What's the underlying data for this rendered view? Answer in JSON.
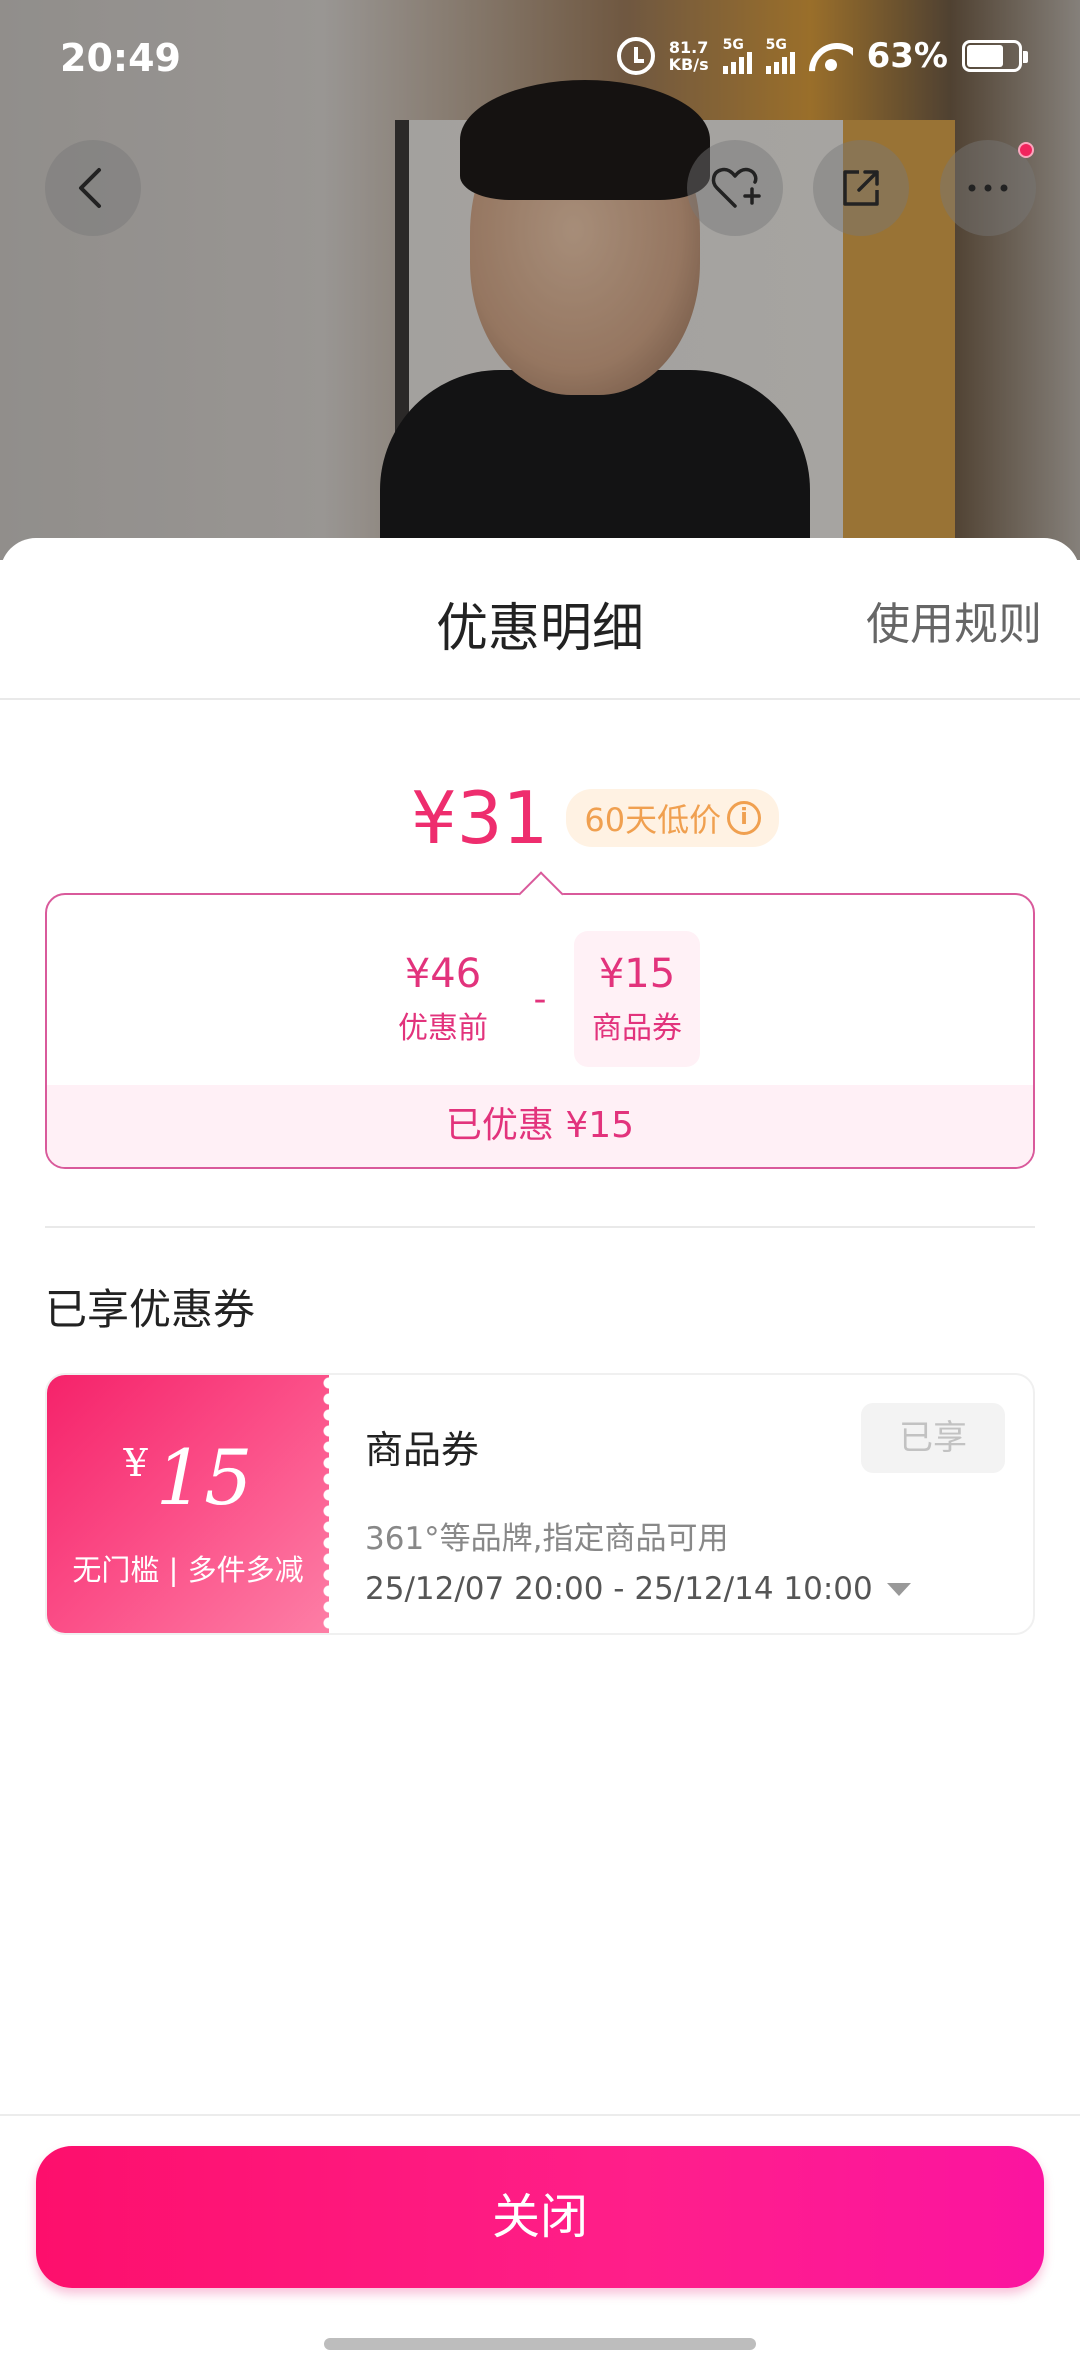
{
  "status_bar": {
    "time": "20:49",
    "net_speed_value": "81.7",
    "net_speed_unit": "KB/s",
    "signal_1": "5G",
    "signal_2": "5G",
    "battery_percent": "63%"
  },
  "header": {
    "title": "优惠明细",
    "rules_link": "使用规则"
  },
  "price": {
    "final_price": "¥31",
    "low_price_badge": "60天低价"
  },
  "calculation": {
    "original_amount": "¥46",
    "original_label": "优惠前",
    "operator": "-",
    "coupon_amount": "¥15",
    "coupon_label": "商品券",
    "total_discount": "已优惠 ¥15"
  },
  "section": {
    "title": "已享优惠券"
  },
  "coupon": {
    "currency": "¥",
    "value": "15",
    "desc": "无门槛 | 多件多减",
    "name": "商品券",
    "status": "已享",
    "scope": "361°等品牌,指定商品可用",
    "validity": "25/12/07 20:00 - 25/12/14 10:00"
  },
  "footer": {
    "close_button": "关闭"
  },
  "colors": {
    "accent": "#ee2d6e",
    "button_gradient_start": "#fd0f6c",
    "button_gradient_end": "#fb14a0",
    "badge_text": "#f0a050"
  }
}
